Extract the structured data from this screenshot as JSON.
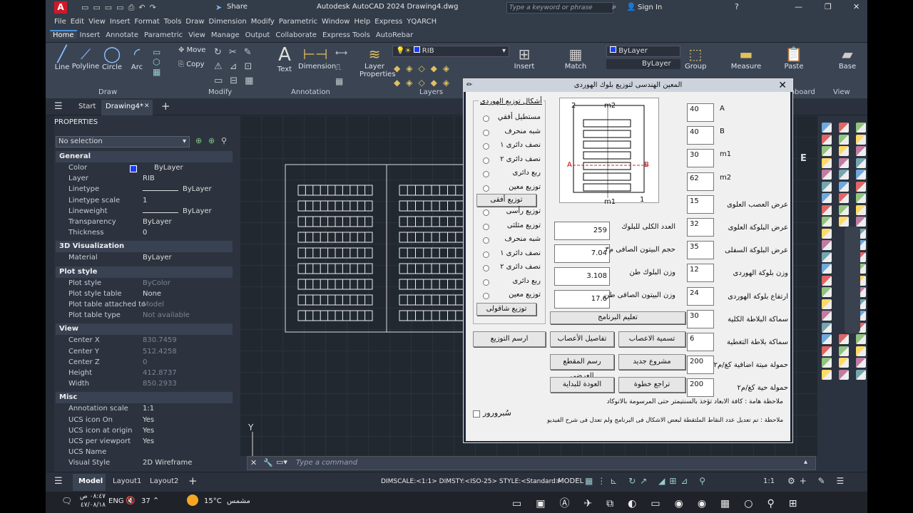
{
  "window": {
    "title": "Autodesk AutoCAD 2024   Drawing4.dwg",
    "search_placeholder": "Type a keyword or phrase",
    "sign_in": "Sign In",
    "share": "Share"
  },
  "menu": [
    "File",
    "Edit",
    "View",
    "Insert",
    "Format",
    "Tools",
    "Draw",
    "Dimension",
    "Modify",
    "Parametric",
    "Window",
    "Help",
    "Express",
    "YQARCH"
  ],
  "ribbon_tabs": [
    "Home",
    "Insert",
    "Annotate",
    "Parametric",
    "View",
    "Manage",
    "Output",
    "Collaborate",
    "Express Tools",
    "AutoRebar"
  ],
  "ribbon": {
    "draw": {
      "line": "Line",
      "polyline": "Polyline",
      "circle": "Circle",
      "arc": "Arc",
      "title": "Draw"
    },
    "modify": {
      "move": "Move",
      "copy": "Copy",
      "title": "Modify"
    },
    "annotation": {
      "text": "Text",
      "dimension": "Dimension",
      "title": "Annotation"
    },
    "layers": {
      "layer_properties": "Layer Properties",
      "layer_name": "RIB",
      "title": "Layers"
    },
    "block": {
      "insert": "Insert"
    },
    "properties": {
      "match": "Match",
      "bylayer1": "ByLayer",
      "bylayer2": "ByLayer",
      "bylayer3": "ByLayer"
    },
    "groups": {
      "group": "Group"
    },
    "utilities": {
      "measure": "Measure"
    },
    "clipboard": {
      "paste": "Paste",
      "title": "lipboard"
    },
    "view": {
      "base": "Base",
      "title": "View"
    }
  },
  "doc_tabs": {
    "start": "Start",
    "drawing": "Drawing4*"
  },
  "properties": {
    "header": "PROPERTIES",
    "selection": "No selection",
    "sections": {
      "general": {
        "title": "General",
        "rows": [
          [
            "Color",
            "ByLayer"
          ],
          [
            "Layer",
            "RIB"
          ],
          [
            "Linetype",
            "ByLayer"
          ],
          [
            "Linetype scale",
            "1"
          ],
          [
            "Lineweight",
            "ByLayer"
          ],
          [
            "Transparency",
            "ByLayer"
          ],
          [
            "Thickness",
            "0"
          ]
        ]
      },
      "viz": {
        "title": "3D Visualization",
        "rows": [
          [
            "Material",
            "ByLayer"
          ]
        ]
      },
      "plot": {
        "title": "Plot style",
        "rows": [
          [
            "Plot style",
            "ByColor"
          ],
          [
            "Plot style table",
            "None"
          ],
          [
            "Plot table attached to",
            "Model"
          ],
          [
            "Plot table type",
            "Not available"
          ]
        ]
      },
      "view": {
        "title": "View",
        "rows": [
          [
            "Center X",
            "830.7459"
          ],
          [
            "Center Y",
            "512.4258"
          ],
          [
            "Center Z",
            "0"
          ],
          [
            "Height",
            "412.8737"
          ],
          [
            "Width",
            "850.2933"
          ]
        ]
      },
      "misc": {
        "title": "Misc",
        "rows": [
          [
            "Annotation scale",
            "1:1"
          ],
          [
            "UCS icon On",
            "Yes"
          ],
          [
            "UCS icon at origin",
            "Yes"
          ],
          [
            "UCS per viewport",
            "Yes"
          ],
          [
            "UCS Name",
            ""
          ],
          [
            "Visual Style",
            "2D Wireframe"
          ]
        ]
      }
    }
  },
  "command": {
    "placeholder": "Type a command"
  },
  "status": {
    "layout_tabs": [
      "Model",
      "Layout1",
      "Layout2"
    ],
    "dim_info": "DIMSCALE:<1:1> DIMSTY:<ISO-25> STYLE:<Standard>",
    "model": "MODEL",
    "scale": "1:1"
  },
  "taskbar": {
    "time": "٠٨:٤٧ ص",
    "date": "٤٧/٠٨/١٨",
    "lang": "ENG",
    "battery": "37",
    "temp": "15°C",
    "weather": "مشمس"
  },
  "dialog": {
    "title": "المعين الهندسى لتوزيع بلوك الهوردى",
    "group_title": "أشكال توزيع الهوردى",
    "radios_h": [
      "مستطيل أفقي",
      "شبه منحرف",
      "نصف دائرى ١",
      "نصف دائرى ٢",
      "ربع دائرى",
      "توزيع معين"
    ],
    "btn_h": "توزيع أفقى",
    "radios_v": [
      "توزيع رأسى",
      "توزيع مثلثى",
      "شبه منحرف",
      "نصف دائرى ١",
      "نصف دائرى ٢",
      "ربع دائرى",
      "توزيع معين"
    ],
    "btn_v": "توزيع شاقولى",
    "btn_draw": "ارسم التوزيع",
    "diagram": {
      "two": "2",
      "one": "1",
      "m2": "m2",
      "m1": "m1",
      "a": "A",
      "b": "B"
    },
    "results": [
      {
        "label": "العدد الكلى للبلوك",
        "value": "259"
      },
      {
        "label": "حجم البيتون الصافى م٣",
        "value": "7.04"
      },
      {
        "label": "وزن البلوك طن",
        "value": "3.108"
      },
      {
        "label": "وزن البيتون الصافى طن",
        "value": "17.6"
      }
    ],
    "params": [
      {
        "label": "A",
        "value": "40"
      },
      {
        "label": "B",
        "value": "40"
      },
      {
        "label": "m1",
        "value": "30"
      },
      {
        "label": "m2",
        "value": "62"
      },
      {
        "label": "عرض العصب العلوى",
        "value": "15"
      },
      {
        "label": "عرض البلوكة العلوى",
        "value": "32"
      },
      {
        "label": "عرض البلوكة السفلى",
        "value": "35"
      },
      {
        "label": "وزن بلوكة الهوردى",
        "value": "12"
      },
      {
        "label": "ارتفاع بلوكة الهوردى",
        "value": "24"
      },
      {
        "label": "سماكة البلاطة الكلية",
        "value": "30"
      },
      {
        "label": "سماكة بلاطة التغطية",
        "value": "6"
      },
      {
        "label": "حمولة ميتة اضافية كغ/م٢",
        "value": "200"
      },
      {
        "label": "حمولة حية كغ/م٢",
        "value": "200"
      }
    ],
    "buttons": {
      "teach": "تعليم البرنامج",
      "naming": "تسمية الاعصاب",
      "details": "تفاصيل الأعصاب",
      "new": "مشروع جديد",
      "section": "رسم المقطع العرضى",
      "undo": "تراجع خطوة",
      "back": "العودة للبداية"
    },
    "note1": "ملاحظة هامة : كافة الابعاد تؤخذ بالسنتيمتر حتى المرسومة بالاتوكاد",
    "note2": "ملاحظة : تم تعديل عدد النقاط الملتقطة لبعض الاشكال فى البرنامج ولم تعدل فى شرح الفيديو",
    "checkbox": "سُبرورور"
  },
  "colors": {
    "accent": "#4a90d9",
    "bylayer_swatch": "#1a3cff"
  }
}
